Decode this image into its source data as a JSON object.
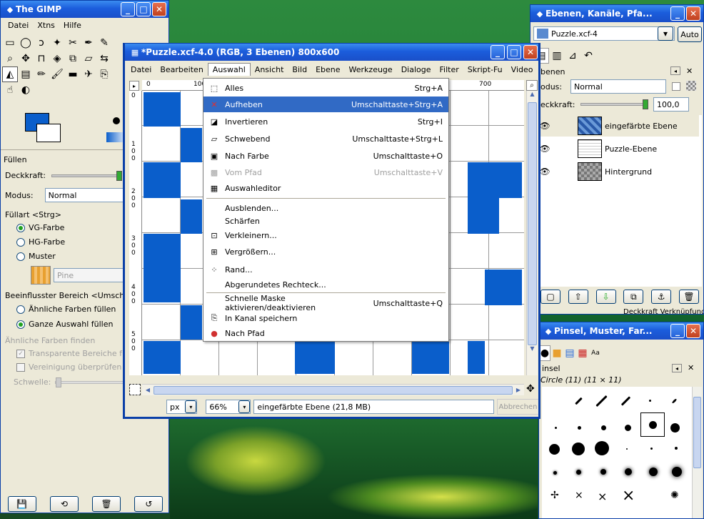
{
  "toolbox": {
    "title": "The GIMP",
    "menu": [
      "Datei",
      "Xtns",
      "Hilfe"
    ],
    "tool_section": "Füllen",
    "opacity_label": "Deckkraft:",
    "mode_label": "Modus:",
    "mode_value": "Normal",
    "fill_type_label": "Füllart  <Strg>",
    "fill_options": [
      "VG-Farbe",
      "HG-Farbe",
      "Muster"
    ],
    "pattern_name": "Pine",
    "affected_label": "Beeinflusster Bereich <Umschalta",
    "affected_options": [
      "Ähnliche Farben füllen",
      "Ganze Auswahl füllen"
    ],
    "similar_label": "Ähnliche Farben finden",
    "transparent_label": "Transparente Bereiche fülle",
    "merge_label": "Vereinigung überprüfen",
    "threshold_label": "Schwelle:"
  },
  "image_window": {
    "title": "*Puzzle.xcf-4.0 (RGB, 3 Ebenen) 800x600",
    "menu": [
      "Datei",
      "Bearbeiten",
      "Auswahl",
      "Ansicht",
      "Bild",
      "Ebene",
      "Werkzeuge",
      "Dialoge",
      "Filter",
      "Skript-Fu",
      "Video"
    ],
    "ruler_marks": [
      "0",
      "100",
      "700"
    ],
    "vruler_marks": [
      "0",
      "1\n0\n0",
      "2\n0\n0",
      "3\n0\n0",
      "4\n0\n0",
      "5\n0\n0"
    ],
    "unit": "px",
    "zoom": "66%",
    "status": "eingefärbte Ebene (21,8 MB)",
    "cancel": "Abbrechen"
  },
  "select_menu": {
    "items": [
      {
        "label": "Alles",
        "accel": "Strg+A",
        "icon": "select-all-icon"
      },
      {
        "label": "Aufheben",
        "accel": "Umschalttaste+Strg+A",
        "icon": "select-none-icon",
        "highlight": true
      },
      {
        "label": "Invertieren",
        "accel": "Strg+I",
        "icon": "invert-icon"
      },
      {
        "label": "Schwebend",
        "accel": "Umschalttaste+Strg+L",
        "icon": "float-icon"
      },
      {
        "label": "Nach Farbe",
        "accel": "Umschalttaste+O",
        "icon": "by-color-icon"
      },
      {
        "label": "Vom Pfad",
        "accel": "Umschalttaste+V",
        "icon": "from-path-icon",
        "disabled": true
      },
      {
        "label": "Auswahleditor",
        "accel": "",
        "icon": "selection-editor-icon"
      },
      {
        "label": "Ausblenden...",
        "accel": "",
        "icon": ""
      },
      {
        "label": "Schärfen",
        "accel": "",
        "icon": ""
      },
      {
        "label": "Verkleinern...",
        "accel": "",
        "icon": "shrink-icon"
      },
      {
        "label": "Vergrößern...",
        "accel": "",
        "icon": "grow-icon"
      },
      {
        "label": "Rand...",
        "accel": "",
        "icon": "border-icon"
      },
      {
        "label": "Abgerundetes Rechteck...",
        "accel": "",
        "icon": ""
      },
      {
        "label": "Schnelle Maske aktivieren/deaktivieren",
        "accel": "Umschalttaste+Q",
        "icon": ""
      },
      {
        "label": "In Kanal speichern",
        "accel": "",
        "icon": "save-channel-icon"
      },
      {
        "label": "Nach Pfad",
        "accel": "",
        "icon": "to-path-icon"
      }
    ]
  },
  "layers_dialog": {
    "title": "Ebenen, Kanäle, Pfa...",
    "image_select": "Puzzle.xcf-4",
    "auto": "Auto",
    "tab_label": "benen",
    "mode_label": "odus:",
    "mode_value": "Normal",
    "opacity_label": "eckkraft:",
    "opacity_value": "100,0",
    "layers": [
      {
        "name": "eingefärbte Ebene"
      },
      {
        "name": "Puzzle-Ebene"
      },
      {
        "name": "Hintergrund"
      }
    ],
    "footer_text": "Deckkraft Verknüpfung"
  },
  "brushes_dialog": {
    "title": "Pinsel, Muster, Far...",
    "tab_label": "insel",
    "brush_info": "Circle (11) (11 × 11)"
  },
  "colors": {
    "fg": "#0a5ecb",
    "bg": "#ffffff",
    "title_blue": "#1b5ddc",
    "highlight": "#316ac5"
  }
}
